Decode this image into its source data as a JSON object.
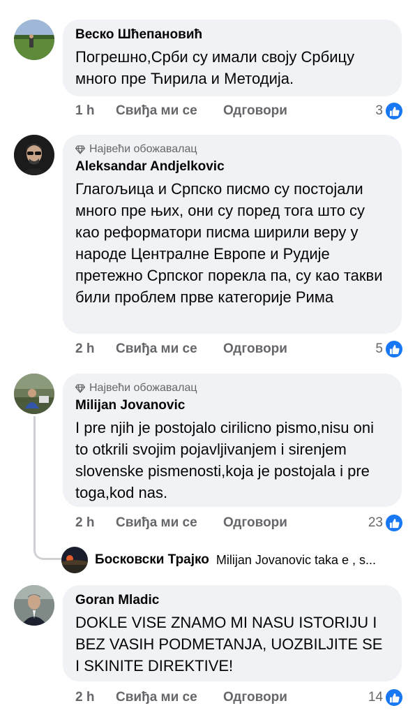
{
  "comments": [
    {
      "author": "Веско Шћепановић",
      "badge": "",
      "text": "Погрешно,Срби су имали своју Србицу много пре Ћирила и Методија.",
      "time": "1 h",
      "like_label": "Свиђа ми се",
      "reply_label": "Одговори",
      "reactions": "3"
    },
    {
      "author": "Aleksandar Andjelkovic",
      "badge": "Највећи обожавалац",
      "text": "Глагољица и Српско писмо су постојали много пре њих, они су поред тога што су као реформатори писма ширили веру у народе Централне Европе и Рудије претежно Српског порекла па, су као такви били проблем прве категорије Рима",
      "time": "2 h",
      "like_label": "Свиђа ми се",
      "reply_label": "Одговори",
      "reactions": "5"
    },
    {
      "author": "Milijan Jovanovic",
      "badge": "Највећи обожавалац",
      "text": "I pre njih je postojalo cirilicno pismo,nisu oni to otkrili svojim pojavljivanjem i sirenjem slovenske pismenosti,koja je postojala i pre toga,kod nas.",
      "time": "2 h",
      "like_label": "Свиђа ми се",
      "reply_label": "Одговори",
      "reactions": "23"
    },
    {
      "author": "Goran Mladic",
      "badge": "",
      "text": "DOKLE VISE ZNAMO MI NASU ISTORIJU I BEZ VASIH PODMETANJA, UOZBILJITE SE I SKINITE DIREKTIVE!",
      "time": "2 h",
      "like_label": "Свиђа ми се",
      "reply_label": "Одговори",
      "reactions": "14"
    }
  ],
  "reply_preview": {
    "author": "Босковски Трајко",
    "snippet": "Milijan Jovanovic taka e , s..."
  },
  "colors": {
    "bubble": "#f0f2f5",
    "meta": "#65676b",
    "like_blue": "#1877f2",
    "thread_line": "#ced0d4"
  },
  "icons": {
    "badge": "diamond-icon",
    "reaction": "thumbs-up-icon"
  }
}
